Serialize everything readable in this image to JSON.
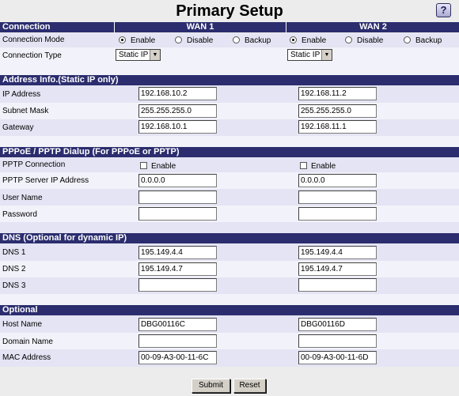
{
  "title": "Primary Setup",
  "help_icon": "help-icon",
  "header": {
    "section": "Connection",
    "wan1": "WAN 1",
    "wan2": "WAN 2"
  },
  "connection": {
    "mode_label": "Connection Mode",
    "type_label": "Connection Type",
    "mode_options": [
      "Enable",
      "Disable",
      "Backup"
    ],
    "wan1_mode": "Enable",
    "wan2_mode": "Enable",
    "wan1_type": "Static IP",
    "wan2_type": "Static IP"
  },
  "address": {
    "section": "Address Info.(Static IP only)",
    "ip_label": "IP Address",
    "mask_label": "Subnet Mask",
    "gw_label": "Gateway",
    "wan1": {
      "ip": "192.168.10.2",
      "mask": "255.255.255.0",
      "gw": "192.168.10.1"
    },
    "wan2": {
      "ip": "192.168.11.2",
      "mask": "255.255.255.0",
      "gw": "192.168.11.1"
    }
  },
  "pppoe": {
    "section": "PPPoE / PPTP Dialup (For PPPoE or PPTP)",
    "pptp_label": "PPTP Connection",
    "server_label": "PPTP Server IP Address",
    "user_label": "User Name",
    "pass_label": "Password",
    "enable_label": "Enable",
    "wan1": {
      "server": "0.0.0.0",
      "user": "",
      "pass": ""
    },
    "wan2": {
      "server": "0.0.0.0",
      "user": "",
      "pass": ""
    }
  },
  "dns": {
    "section": "DNS (Optional for dynamic IP)",
    "dns1_label": "DNS 1",
    "dns2_label": "DNS 2",
    "dns3_label": "DNS 3",
    "wan1": {
      "dns1": "195.149.4.4",
      "dns2": "195.149.4.7",
      "dns3": ""
    },
    "wan2": {
      "dns1": "195.149.4.4",
      "dns2": "195.149.4.7",
      "dns3": ""
    }
  },
  "optional": {
    "section": "Optional",
    "host_label": "Host Name",
    "domain_label": "Domain Name",
    "mac_label": "MAC Address",
    "wan1": {
      "host": "DBG00116C",
      "domain": "",
      "mac": "00-09-A3-00-11-6C"
    },
    "wan2": {
      "host": "DBG00116D",
      "domain": "",
      "mac": "00-09-A3-00-11-6D"
    }
  },
  "buttons": {
    "submit": "Submit",
    "reset": "Reset"
  }
}
